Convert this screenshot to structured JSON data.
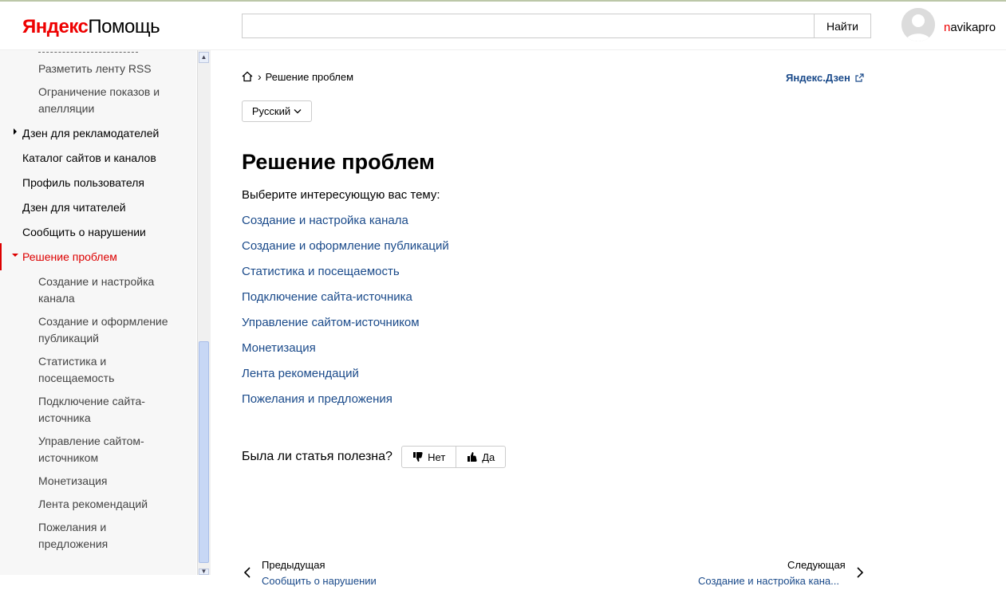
{
  "header": {
    "brand": "Яндекс",
    "service": "Помощь",
    "search_button": "Найти",
    "search_value": "",
    "username_first": "n",
    "username_rest": "avikapro"
  },
  "sidebar": {
    "items": [
      {
        "label": "Разметить ленту RSS",
        "level": "sub"
      },
      {
        "label": "Ограничение показов и",
        "label2": "апелляции",
        "level": "sub"
      },
      {
        "label": "Дзен для рекламодателей",
        "level": "top",
        "collapsed": true
      },
      {
        "label": "Каталог сайтов и каналов",
        "level": "top"
      },
      {
        "label": "Профиль пользователя",
        "level": "top"
      },
      {
        "label": "Дзен для читателей",
        "level": "top"
      },
      {
        "label": "Сообщить о нарушении",
        "level": "top"
      },
      {
        "label": "Решение проблем",
        "level": "top",
        "active": true,
        "expanded": true
      },
      {
        "label": "Создание и настройка",
        "label2": "канала",
        "level": "sub"
      },
      {
        "label": "Создание и оформление",
        "label2": "публикаций",
        "level": "sub"
      },
      {
        "label": "Статистика и",
        "label2": "посещаемость",
        "level": "sub"
      },
      {
        "label": "Подключение сайта-",
        "label2": "источника",
        "level": "sub"
      },
      {
        "label": "Управление сайтом-",
        "label2": "источником",
        "level": "sub"
      },
      {
        "label": "Монетизация",
        "level": "sub"
      },
      {
        "label": "Лента рекомендаций",
        "level": "sub"
      },
      {
        "label": "Пожелания и",
        "label2": "предложения",
        "level": "sub"
      }
    ]
  },
  "breadcrumb": {
    "current": "Решение проблем"
  },
  "service_link": "Яндекс.Дзен",
  "language": "Русский",
  "main": {
    "title": "Решение проблем",
    "intro": "Выберите интересующую вас тему:",
    "topics": [
      "Создание и настройка канала",
      "Создание и оформление публикаций",
      "Статистика и посещаемость",
      "Подключение сайта-источника",
      "Управление сайтом-источником",
      "Монетизация",
      "Лента рекомендаций",
      "Пожелания и предложения"
    ]
  },
  "feedback": {
    "question": "Была ли статья полезна?",
    "no": "Нет",
    "yes": "Да"
  },
  "pagination": {
    "prev_label": "Предыдущая",
    "prev_title": "Сообщить о нарушении",
    "next_label": "Следующая",
    "next_title": "Создание и настройка кана..."
  },
  "colors": {
    "brand_red": "#ee0000",
    "link_blue": "#1a4a8a",
    "active_red": "#dd0000"
  }
}
